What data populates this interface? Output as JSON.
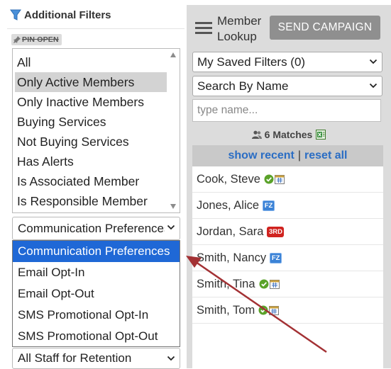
{
  "filters": {
    "title": "Additional Filters",
    "pin_label": "PIN OPEN",
    "items": [
      "All",
      "Only Active Members",
      "Only Inactive Members",
      "Buying Services",
      "Not Buying Services",
      "Has Alerts",
      "Is Associated Member",
      "Is Responsible Member"
    ],
    "selected_item": "Only Active Members",
    "communication_select": "Communication Preferences",
    "communication_options": [
      "Communication Preferences",
      "Email Opt-In",
      "Email Opt-Out",
      "SMS Promotional Opt-In",
      "SMS Promotional Opt-Out"
    ],
    "staff_select": "All Staff for Retention"
  },
  "lookup": {
    "title_line1": "Member",
    "title_line2": "Lookup",
    "send_button": "SEND CAMPAIGN",
    "saved_filters": "My Saved Filters (0)",
    "search_by": "Search By Name",
    "search_placeholder": "type name...",
    "matches": "6 Matches",
    "show_recent": "show recent",
    "separator": "|",
    "reset_all": "reset all",
    "members": [
      {
        "name": "Cook, Steve",
        "badges": [
          "check-icon",
          "calendar-icon"
        ]
      },
      {
        "name": "Jones, Alice",
        "badges": [
          "FZ"
        ]
      },
      {
        "name": "Jordan, Sara",
        "badges": [
          "3RD"
        ]
      },
      {
        "name": "Smith, Nancy",
        "badges": [
          "FZ"
        ]
      },
      {
        "name": "Smith, Tina",
        "badges": [
          "check-icon",
          "calendar-icon"
        ]
      },
      {
        "name": "Smith, Tom",
        "badges": [
          "check-icon",
          "calendar-icon"
        ]
      }
    ]
  },
  "colors": {
    "highlight": "#1f68d6",
    "link": "#2a6dc4",
    "arrow": "#a33134",
    "check": "#5aa229",
    "third_badge": "#d0231f",
    "fz_badge": "#3b82d6"
  }
}
